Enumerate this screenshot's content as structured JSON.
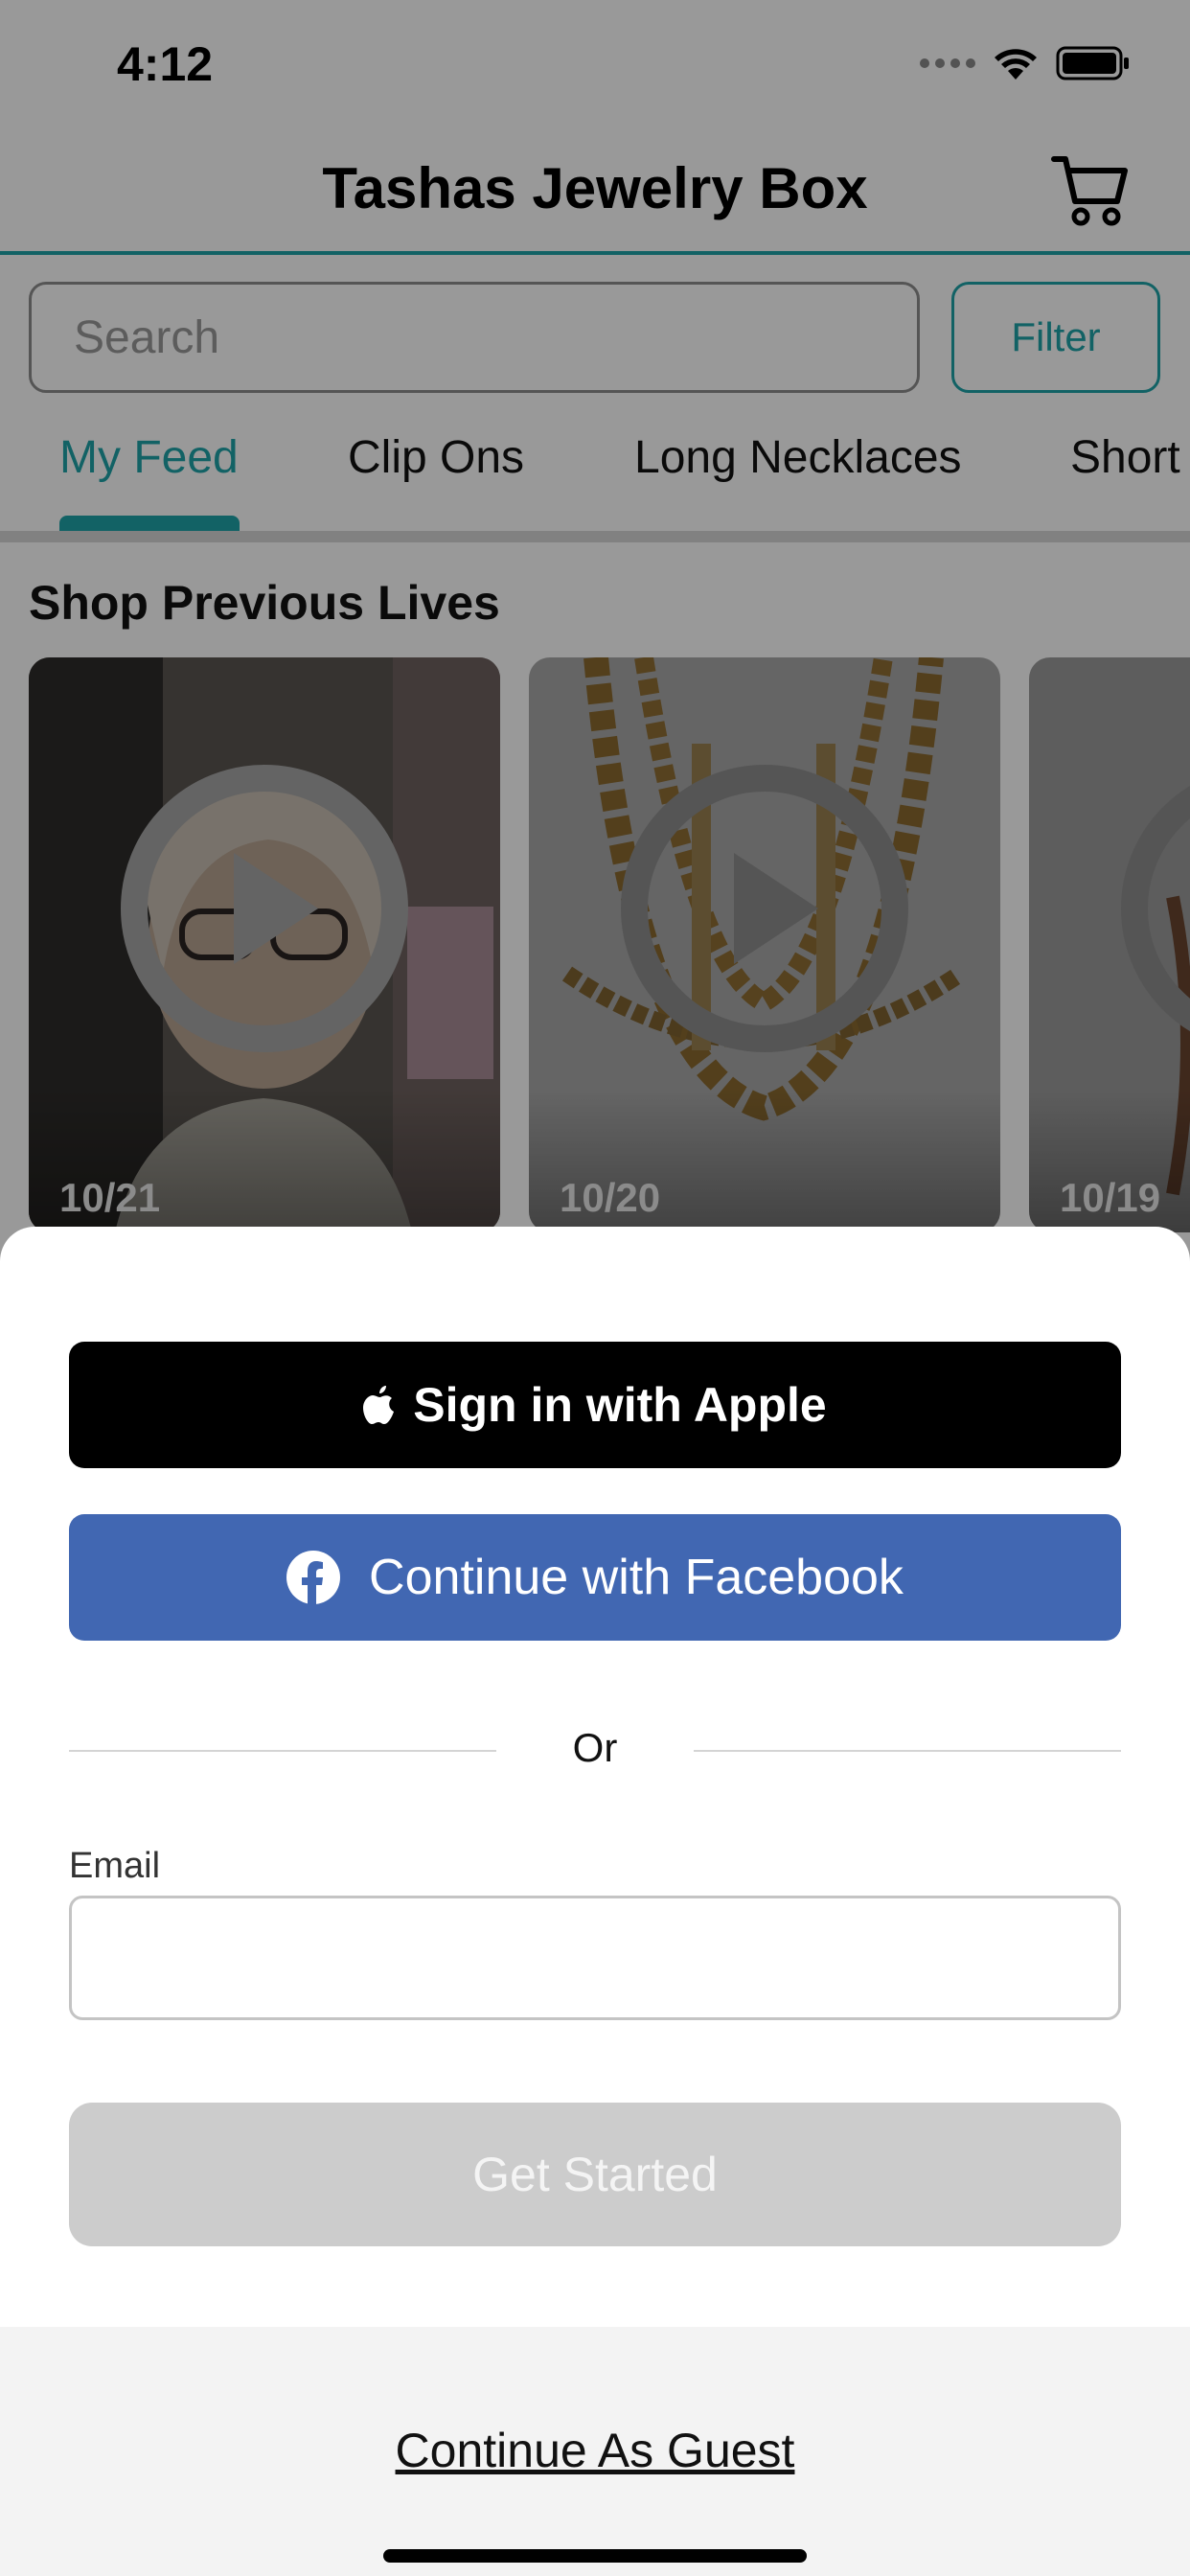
{
  "status_bar": {
    "time": "4:12"
  },
  "header": {
    "title": "Tashas Jewelry Box",
    "cart_icon": "cart-icon"
  },
  "search": {
    "placeholder": "Search",
    "value": "",
    "filter_label": "Filter"
  },
  "tabs": [
    {
      "label": "My Feed",
      "active": true
    },
    {
      "label": "Clip Ons",
      "active": false
    },
    {
      "label": "Long Necklaces",
      "active": false
    },
    {
      "label": "Short",
      "active": false
    }
  ],
  "previous_lives": {
    "title": "Shop Previous Lives",
    "items": [
      {
        "date": "10/21"
      },
      {
        "date": "10/20"
      },
      {
        "date": "10/19"
      }
    ]
  },
  "sheet": {
    "apple_label": "Sign in with Apple",
    "facebook_label": "Continue with Facebook",
    "or_label": "Or",
    "email_label": "Email",
    "email_value": "",
    "get_started_label": "Get Started",
    "guest_label": "Continue As Guest"
  },
  "colors": {
    "accent": "#1fa3a8",
    "facebook": "#4167b2",
    "apple": "#000000",
    "disabled_button": "#cccccc"
  }
}
